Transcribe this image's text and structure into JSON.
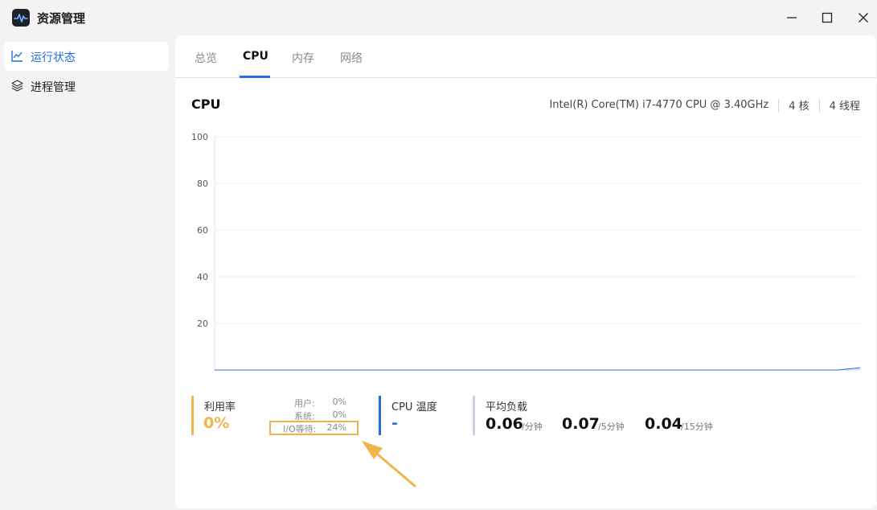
{
  "window": {
    "title": "资源管理",
    "icon": "activity-waveform-icon"
  },
  "sidebar": {
    "items": [
      {
        "label": "运行状态",
        "icon": "line-chart-icon",
        "active": true
      },
      {
        "label": "进程管理",
        "icon": "layers-icon",
        "active": false
      }
    ]
  },
  "tabs": [
    {
      "label": "总览",
      "active": false
    },
    {
      "label": "CPU",
      "active": true
    },
    {
      "label": "内存",
      "active": false
    },
    {
      "label": "网络",
      "active": false
    }
  ],
  "cpu": {
    "heading": "CPU",
    "model": "Intel(R) Core(TM) i7-4770 CPU @ 3.40GHz",
    "cores": "4 核",
    "threads": "4 线程"
  },
  "chart_data": {
    "type": "area",
    "title": "",
    "xlabel": "",
    "ylabel": "",
    "ylim": [
      0,
      100
    ],
    "yticks": [
      100,
      80,
      60,
      40,
      20
    ],
    "series": [
      {
        "values": [
          0,
          0,
          0,
          0,
          0,
          0,
          0,
          0,
          0,
          0,
          0,
          0,
          0,
          0,
          0,
          0,
          0,
          0,
          0,
          0,
          0,
          0,
          0,
          0,
          0,
          0,
          0,
          0,
          0,
          1
        ]
      }
    ],
    "grid": true,
    "color": "#1f6fe0"
  },
  "utilization": {
    "label": "利用率",
    "value": "0%",
    "color": "#f0b44c",
    "user_label": "用户:",
    "user_value": "0%",
    "system_label": "系统:",
    "system_value": "0%",
    "iowait_label": "I/O等待:",
    "iowait_value": "24%"
  },
  "temperature": {
    "label": "CPU 温度",
    "value": "-",
    "color": "#1f6fe0"
  },
  "load": {
    "label": "平均负载",
    "items": [
      {
        "value": "0.06",
        "unit": "/分钟"
      },
      {
        "value": "0.07",
        "unit": "/5分钟"
      },
      {
        "value": "0.04",
        "unit": "/15分钟"
      }
    ]
  },
  "annotation": {
    "arrow_color": "#f0b44c"
  }
}
